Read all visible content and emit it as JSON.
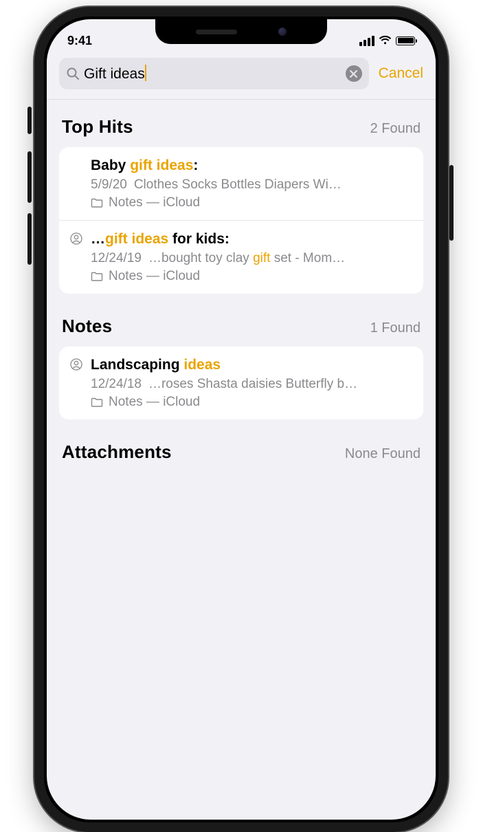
{
  "status": {
    "time": "9:41"
  },
  "search": {
    "value": "Gift ideas",
    "cancel": "Cancel"
  },
  "sections": {
    "tophits": {
      "title": "Top Hits",
      "count": "2 Found",
      "items": [
        {
          "shared": false,
          "title_pre": "Baby ",
          "title_hl": "gift ideas",
          "title_post": ":",
          "date": "5/9/20",
          "preview_pre": "Clothes Socks Bottles Diapers Wi…",
          "preview_hl": "",
          "preview_post": "",
          "folder": "Notes — iCloud"
        },
        {
          "shared": true,
          "title_pre": "…",
          "title_hl": "gift ideas",
          "title_post": " for kids:",
          "date": "12/24/19",
          "preview_pre": "…bought toy clay ",
          "preview_hl": "gift",
          "preview_post": " set - Mom…",
          "folder": "Notes — iCloud"
        }
      ]
    },
    "notes": {
      "title": "Notes",
      "count": "1 Found",
      "items": [
        {
          "shared": true,
          "title_pre": "Landscaping ",
          "title_hl": "ideas",
          "title_post": "",
          "date": "12/24/18",
          "preview_pre": "…roses Shasta daisies Butterfly b…",
          "preview_hl": "",
          "preview_post": "",
          "folder": "Notes — iCloud"
        }
      ]
    },
    "attachments": {
      "title": "Attachments",
      "count": "None Found"
    }
  }
}
